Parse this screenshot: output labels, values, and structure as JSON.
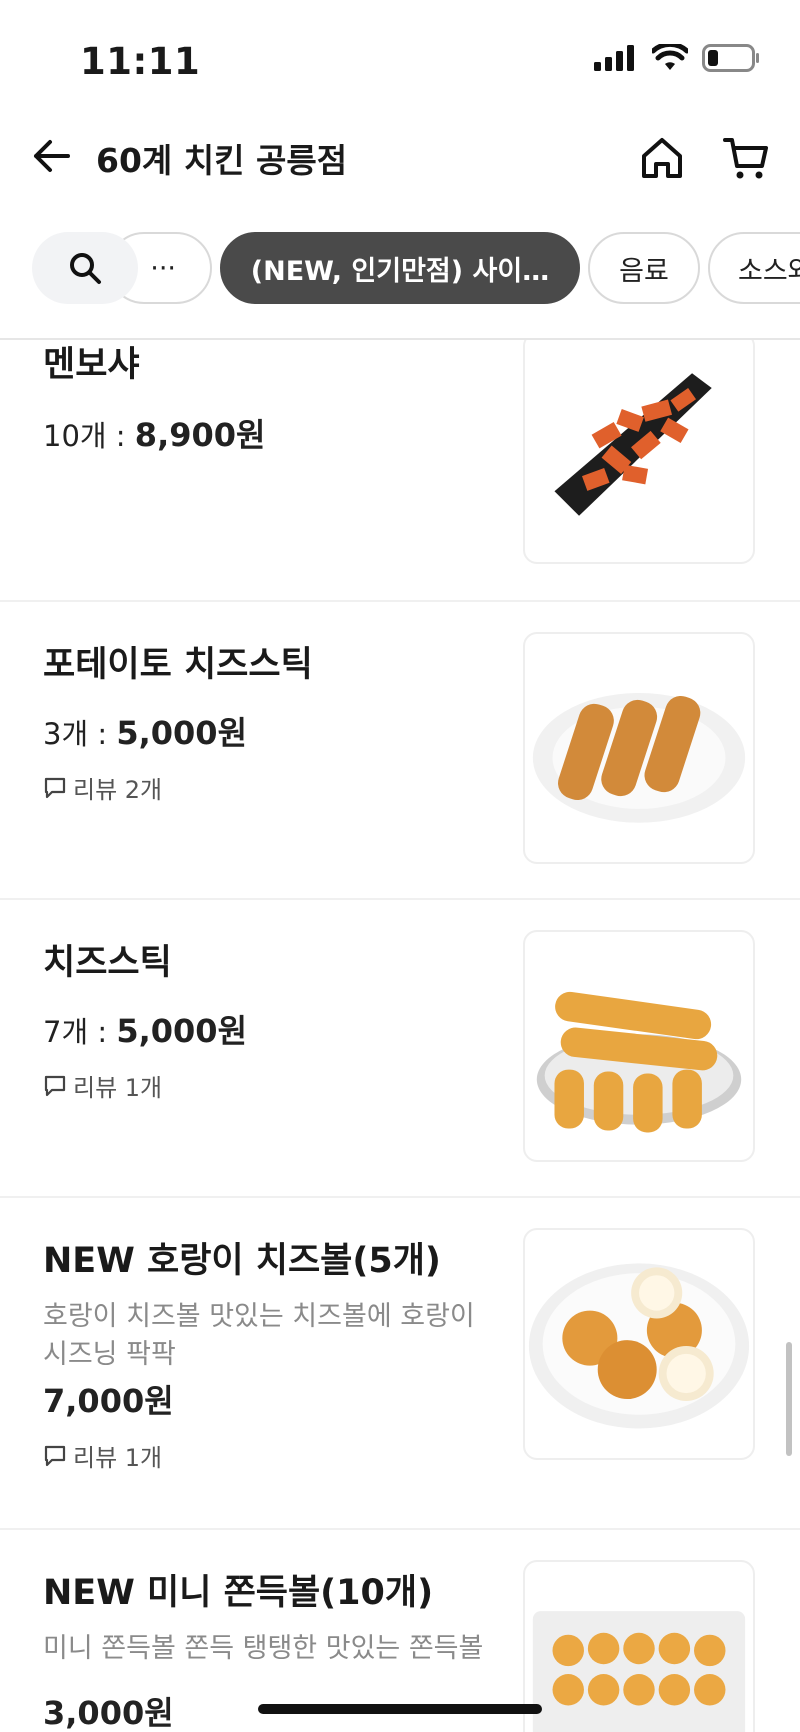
{
  "status": {
    "time": "11:11"
  },
  "nav": {
    "title": "60계 치킨 공릉점"
  },
  "categories": {
    "ellipsis": "···",
    "active": "(NEW, 인기만점) 사이…",
    "drink": "음료",
    "sauce": "소스와"
  },
  "menu": [
    {
      "name": "멘보샤",
      "qty": "10개 : ",
      "price": "8,900원",
      "review": ""
    },
    {
      "name": "포테이토 치즈스틱",
      "qty": "3개 : ",
      "price": "5,000원",
      "review": "리뷰 2개"
    },
    {
      "name": "치즈스틱",
      "qty": "7개 : ",
      "price": "5,000원",
      "review": "리뷰 1개"
    },
    {
      "name": "NEW 호랑이 치즈볼(5개)",
      "desc": "호랑이 치즈볼 맛있는 치즈볼에 호랑이 시즈닝 팍팍",
      "price": "7,000원",
      "review": "리뷰 1개"
    },
    {
      "name": "NEW 미니 쫀득볼(10개)",
      "desc": "미니 쫀득볼 쫀득 탱탱한 맛있는 쫀득볼",
      "price": "3,000원"
    }
  ],
  "icons": [
    "back-arrow-icon",
    "home-icon",
    "cart-icon",
    "search-icon",
    "review-bubble-icon",
    "signal-icon",
    "wifi-icon",
    "battery-icon"
  ],
  "colors": {
    "active_chip": "#4a4a4a",
    "text": "#1a1a1a",
    "muted": "#8a8a8a"
  }
}
